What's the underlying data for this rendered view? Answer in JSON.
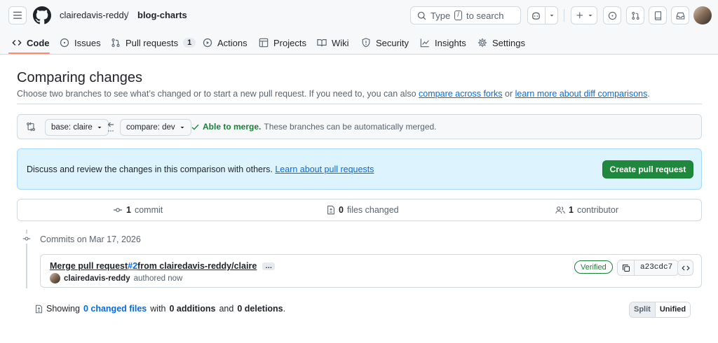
{
  "header": {
    "owner": "clairedavis-reddy",
    "separator": "/",
    "repo": "blog-charts",
    "search_prefix": "Type",
    "search_key": "/",
    "search_suffix": "to search"
  },
  "tabs": [
    {
      "label": "Code",
      "icon": "code-icon",
      "selected": true
    },
    {
      "label": "Issues",
      "icon": "issue-opened-icon"
    },
    {
      "label": "Pull requests",
      "icon": "git-pull-request-icon",
      "count": "1"
    },
    {
      "label": "Actions",
      "icon": "play-icon"
    },
    {
      "label": "Projects",
      "icon": "table-icon"
    },
    {
      "label": "Wiki",
      "icon": "book-icon"
    },
    {
      "label": "Security",
      "icon": "shield-icon"
    },
    {
      "label": "Insights",
      "icon": "graph-icon"
    },
    {
      "label": "Settings",
      "icon": "gear-icon"
    }
  ],
  "page": {
    "title": "Comparing changes",
    "desc_prefix": "Choose two branches to see what’s changed or to start a new pull request. If you need to, you can also ",
    "desc_link1": "compare across forks",
    "desc_mid": " or ",
    "desc_link2": "learn more about diff comparisons",
    "desc_suffix": "."
  },
  "range": {
    "base_label": "base: claire",
    "compare_label": "compare: dev",
    "merge_ok": "Able to merge.",
    "merge_detail": "These branches can be automatically merged."
  },
  "blankslate": {
    "text": "Discuss and review the changes in this comparison with others.",
    "link": "Learn about pull requests",
    "button": "Create pull request"
  },
  "numbers": {
    "commits_count": "1",
    "commits_label": "commit",
    "files_count": "0",
    "files_label": "files changed",
    "contributors_count": "1",
    "contributors_label": "contributor"
  },
  "timeline": {
    "date_heading": "Commits on Mar 17, 2026"
  },
  "commit": {
    "title_prefix": "Merge pull request ",
    "pr_link": "#2",
    "title_suffix": " from clairedavis-reddy/claire",
    "ellipsis": "…",
    "author": "clairedavis-reddy",
    "authored": "authored now",
    "verified": "Verified",
    "sha": "a23cdc7"
  },
  "summary": {
    "prefix": "Showing",
    "changed_files": "0 changed files",
    "with": "with",
    "additions": "0 additions",
    "and": "and",
    "deletions": "0 deletions",
    "period": "."
  },
  "diff_view": {
    "split": "Split",
    "unified": "Unified",
    "selected": "Unified"
  },
  "colors": {
    "primary_button": "#1f883d",
    "link": "#0969da",
    "success": "#1a7f37",
    "tab_underline": "#fd8c73",
    "info_bg": "#ddf4ff"
  }
}
